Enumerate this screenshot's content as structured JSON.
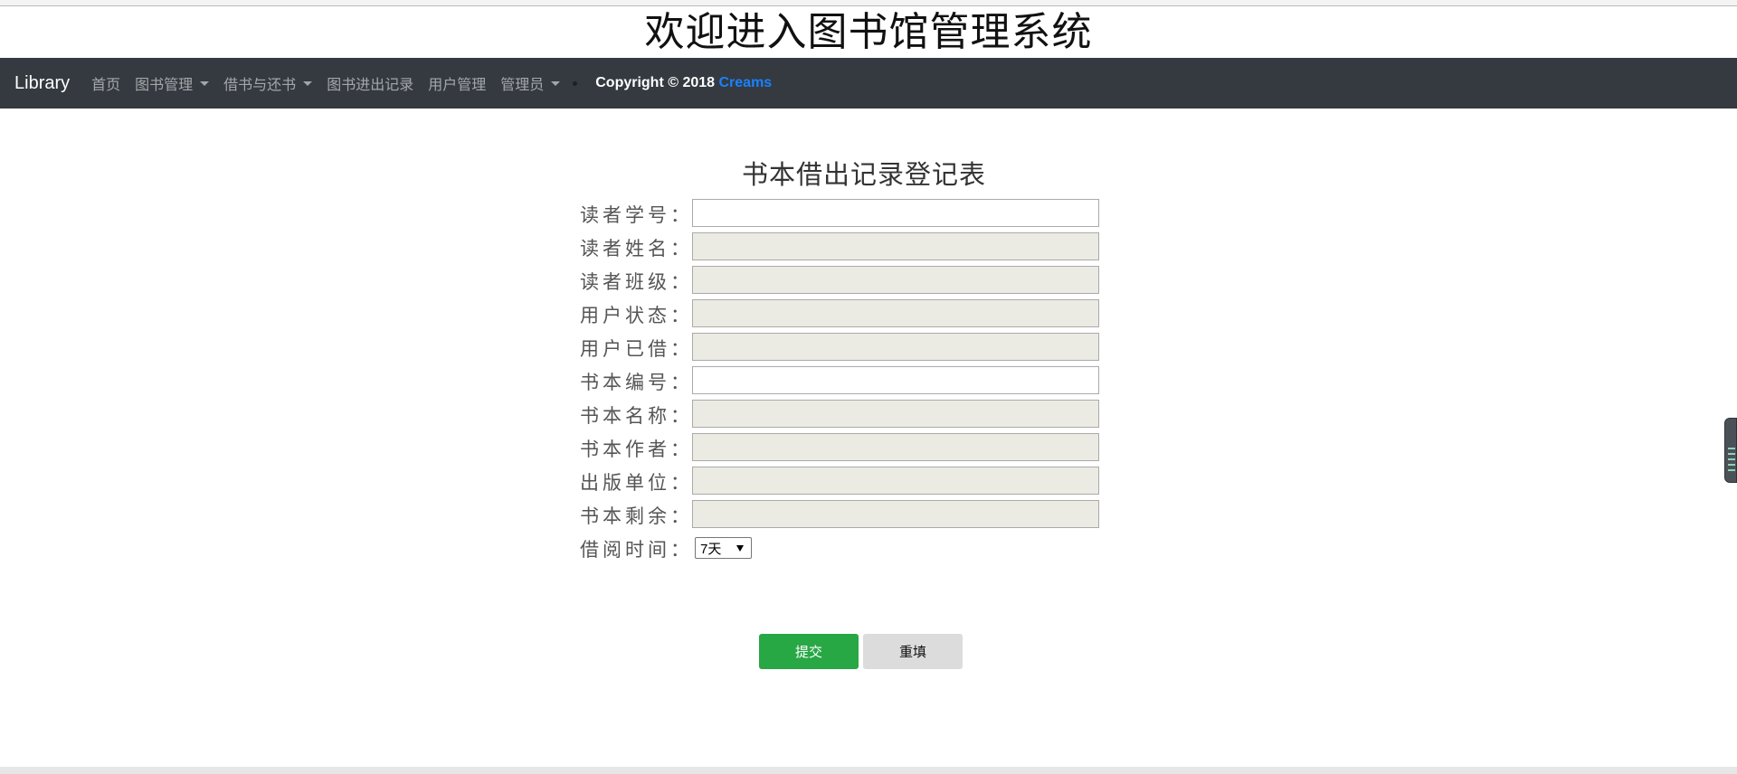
{
  "header": {
    "title": "欢迎进入图书馆管理系统"
  },
  "navbar": {
    "brand": "Library",
    "items": [
      {
        "label": "首页",
        "dropdown": false
      },
      {
        "label": "图书管理",
        "dropdown": true
      },
      {
        "label": "借书与还书",
        "dropdown": true
      },
      {
        "label": "图书进出记录",
        "dropdown": false
      },
      {
        "label": "用户管理",
        "dropdown": false
      },
      {
        "label": "管理员",
        "dropdown": true
      }
    ],
    "copyright_prefix": "Copyright © 2018 ",
    "copyright_author": "Creams"
  },
  "form": {
    "title": "书本借出记录登记表",
    "fields": [
      {
        "label": "读者学号：",
        "value": "",
        "readonly": false
      },
      {
        "label": "读者姓名：",
        "value": "",
        "readonly": true
      },
      {
        "label": "读者班级：",
        "value": "",
        "readonly": true
      },
      {
        "label": "用户状态：",
        "value": "",
        "readonly": true
      },
      {
        "label": "用户已借：",
        "value": "",
        "readonly": true
      },
      {
        "label": "书本编号：",
        "value": "",
        "readonly": false
      },
      {
        "label": "书本名称：",
        "value": "",
        "readonly": true
      },
      {
        "label": "书本作者：",
        "value": "",
        "readonly": true
      },
      {
        "label": "出版单位：",
        "value": "",
        "readonly": true
      },
      {
        "label": "书本剩余：",
        "value": "",
        "readonly": true
      }
    ],
    "borrow_period": {
      "label": "借阅时间：",
      "selected": "7天"
    },
    "submit_label": "提交",
    "reset_label": "重填"
  },
  "colors": {
    "navbar_bg": "#343a40",
    "submit_bg": "#28a745",
    "reset_bg": "#dcdcdc",
    "readonly_bg": "#ebebe4",
    "link_accent": "#1a82ff"
  }
}
